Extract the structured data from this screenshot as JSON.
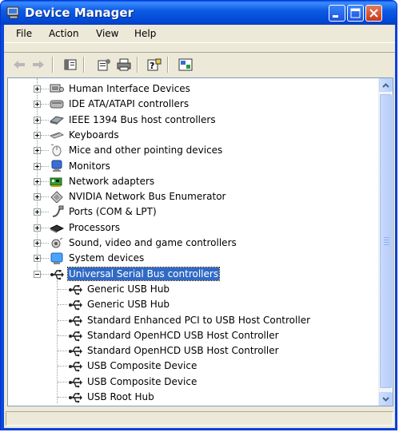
{
  "window": {
    "title": "Device Manager"
  },
  "menu": [
    "File",
    "Action",
    "View",
    "Help"
  ],
  "toolbar": {
    "icons": [
      "back-icon",
      "forward-icon",
      "show-hide-tree-icon",
      "properties-icon",
      "print-icon",
      "help-icon",
      "scan-hardware-icon"
    ]
  },
  "tree": {
    "categories": [
      {
        "label": "Human Interface Devices",
        "icon": "hid-icon"
      },
      {
        "label": "IDE ATA/ATAPI controllers",
        "icon": "ide-icon"
      },
      {
        "label": "IEEE 1394 Bus host controllers",
        "icon": "ieee1394-icon"
      },
      {
        "label": "Keyboards",
        "icon": "keyboard-icon"
      },
      {
        "label": "Mice and other pointing devices",
        "icon": "mouse-icon"
      },
      {
        "label": "Monitors",
        "icon": "monitor-icon"
      },
      {
        "label": "Network adapters",
        "icon": "network-adapter-icon"
      },
      {
        "label": "NVIDIA Network Bus Enumerator",
        "icon": "nvidia-bus-icon"
      },
      {
        "label": "Ports (COM & LPT)",
        "icon": "ports-icon"
      },
      {
        "label": "Processors",
        "icon": "processor-icon"
      },
      {
        "label": "Sound, video and game controllers",
        "icon": "sound-icon"
      },
      {
        "label": "System devices",
        "icon": "system-devices-icon"
      }
    ],
    "expanded": {
      "label": "Universal Serial Bus controllers",
      "icon": "usb-icon",
      "children": [
        "Generic USB Hub",
        "Generic USB Hub",
        "Standard Enhanced PCI to USB Host Controller",
        "Standard OpenHCD USB Host Controller",
        "Standard OpenHCD USB Host Controller",
        "USB Composite Device",
        "USB Composite Device",
        "USB Root Hub"
      ]
    }
  },
  "colors": {
    "titlebar": "#0a49d8",
    "selection": "#316ac5",
    "chrome": "#ece9d8"
  }
}
